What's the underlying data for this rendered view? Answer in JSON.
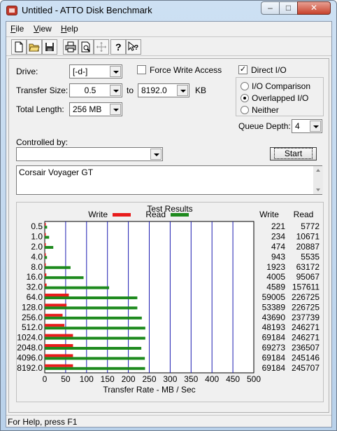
{
  "window": {
    "title": "Untitled - ATTO Disk Benchmark"
  },
  "menu": {
    "items": [
      {
        "label": "File",
        "accel": "F"
      },
      {
        "label": "View",
        "accel": "V"
      },
      {
        "label": "Help",
        "accel": "H"
      }
    ]
  },
  "toolbar": {
    "buttons": [
      "new-icon",
      "open-icon",
      "save-icon",
      "print-icon",
      "print-preview-icon",
      "move-icon",
      "help-icon",
      "context-help-icon"
    ]
  },
  "form": {
    "drive_label": "Drive:",
    "drive_value": "[-d-]",
    "force_write_label": "Force Write Access",
    "force_write_checked": false,
    "direct_io_label": "Direct I/O",
    "direct_io_checked": true,
    "transfer_size_label": "Transfer Size:",
    "transfer_from": "0.5",
    "to_label": "to",
    "transfer_to": "8192.0",
    "kb_label": "KB",
    "total_length_label": "Total Length:",
    "total_length_value": "256 MB",
    "io_options": [
      {
        "label": "I/O Comparison",
        "selected": false
      },
      {
        "label": "Overlapped I/O",
        "selected": true
      },
      {
        "label": "Neither",
        "selected": false
      }
    ],
    "queue_depth_label": "Queue Depth:",
    "queue_depth_value": "4",
    "controlled_by_label": "Controlled by:",
    "controlled_by_value": "",
    "start_label": "Start",
    "description": "Corsair Voyager GT"
  },
  "chart_data": {
    "type": "bar",
    "title": "Test Results",
    "xlabel": "Transfer Rate - MB / Sec",
    "xlim": [
      0,
      500
    ],
    "xticks": [
      0,
      50,
      100,
      150,
      200,
      250,
      300,
      350,
      400,
      450,
      500
    ],
    "categories": [
      "0.5",
      "1.0",
      "2.0",
      "4.0",
      "8.0",
      "16.0",
      "32.0",
      "64.0",
      "128.0",
      "256.0",
      "512.0",
      "1024.0",
      "2048.0",
      "4096.0",
      "8192.0"
    ],
    "series": [
      {
        "name": "Write",
        "color": "#e81c1c",
        "values": [
          221,
          234,
          474,
          943,
          1923,
          4005,
          4589,
          59005,
          53389,
          43690,
          48193,
          69184,
          69273,
          69184,
          69184
        ]
      },
      {
        "name": "Read",
        "color": "#1e8a1e",
        "values": [
          5772,
          10671,
          20887,
          5535,
          63172,
          95067,
          157611,
          226725,
          226725,
          237739,
          246271,
          246271,
          236507,
          245146,
          245707
        ]
      }
    ],
    "table_headers": {
      "write": "Write",
      "read": "Read"
    },
    "bar_scale_note": ""
  },
  "status": {
    "text": "For Help, press F1"
  }
}
